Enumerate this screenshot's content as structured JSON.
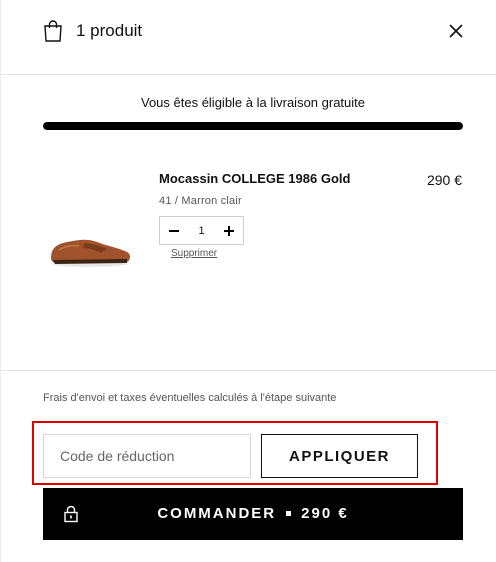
{
  "header": {
    "count_label": "1 produit",
    "bag_icon": "shopping-bag-icon",
    "close_icon": "close-icon"
  },
  "shipping": {
    "message": "Vous êtes éligible à la livraison gratuite",
    "progress_percent": 100
  },
  "cart": {
    "items": [
      {
        "name": "Mocassin COLLEGE 1986 Gold",
        "price": "290 €",
        "variant": "41 / Marron clair",
        "quantity": "1",
        "remove_label": "Supprimer"
      }
    ]
  },
  "footer": {
    "note": "Frais d'envoi et taxes éventuelles calculés à l'étape suivante",
    "promo_placeholder": "Code de réduction",
    "apply_label": "APPLIQUER",
    "checkout_label": "COMMANDER",
    "checkout_total": "290 €",
    "lock_icon": "lock-icon"
  },
  "colors": {
    "accent": "#000000",
    "highlight": "#e00000",
    "shoe": "#a0522d"
  }
}
